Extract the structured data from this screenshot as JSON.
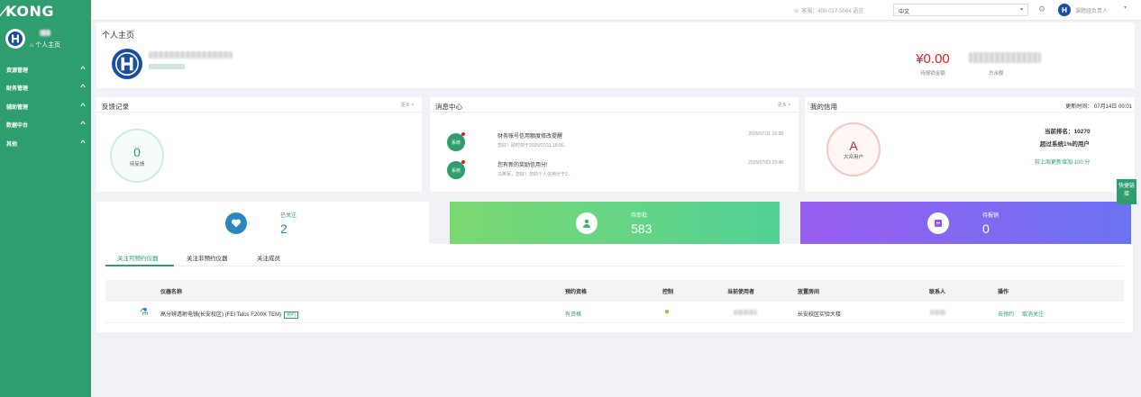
{
  "app": {
    "logo": "KONG"
  },
  "sidebar": {
    "home_label": "个人主页",
    "items": [
      {
        "label": "资源管理"
      },
      {
        "label": "财务管理"
      },
      {
        "label": "辅助管理"
      },
      {
        "label": "数据中台"
      },
      {
        "label": "其他"
      }
    ]
  },
  "topbar": {
    "service": "客服：400-017-5664  语言",
    "language": "中文",
    "user": "课题组负责人"
  },
  "profile": {
    "title": "个人主页",
    "balance": "¥0.00",
    "balance_label": "待报销金额",
    "total_label": "总余额"
  },
  "feedback": {
    "title": "反馈记录",
    "more": "更多 >",
    "count": "0",
    "label": "待反馈"
  },
  "messages": {
    "title": "消息中心",
    "more": "更多 >",
    "items": [
      {
        "icon_label": "系统",
        "title": "财务账号信用额度修改提醒",
        "body": "您好！即时刻于2025/07/11 16:56...",
        "time": "2025/07/11 16:38"
      },
      {
        "icon_label": "系统",
        "title": "您有新的奖励信用分!",
        "body": "马英军，您好！您的个人信用分于2...",
        "time": "2025/07/03 23:48"
      }
    ]
  },
  "credit": {
    "title": "我的信用",
    "update": "更新时间： 07月14日 00:01",
    "grade": "A",
    "grade_label": "大众用户",
    "rank": "当前排名：10270",
    "percent": "超过系统1%的用户",
    "increase": "较上周更新增加 100 分"
  },
  "stats": {
    "followed": {
      "label": "已关注",
      "value": "2",
      "color": "#2e86c1"
    },
    "pending_review": {
      "label": "待审批",
      "value": "583",
      "color": "#7dd87a"
    },
    "pending_reimburse": {
      "label": "待报销",
      "value": "0",
      "color": "#8e5cf0"
    }
  },
  "tabs": [
    {
      "label": "关注可预约仪器"
    },
    {
      "label": "关注非预约仪器"
    },
    {
      "label": "关注成员"
    }
  ],
  "table": {
    "headers": [
      "仪器名称",
      "预约资格",
      "控制",
      "当前使用者",
      "放置房间",
      "联系人",
      "操作"
    ],
    "rows": [
      {
        "name": "高分辨透射电镜(长安校区)  (FEI Talos F200X TEM)",
        "tag": "预约",
        "qualification": "有资格",
        "room": "长安校区实验大楼",
        "action_book": "去预约",
        "action_unfollow": "取消关注"
      }
    ]
  },
  "quick": {
    "label": "快捷链接"
  }
}
